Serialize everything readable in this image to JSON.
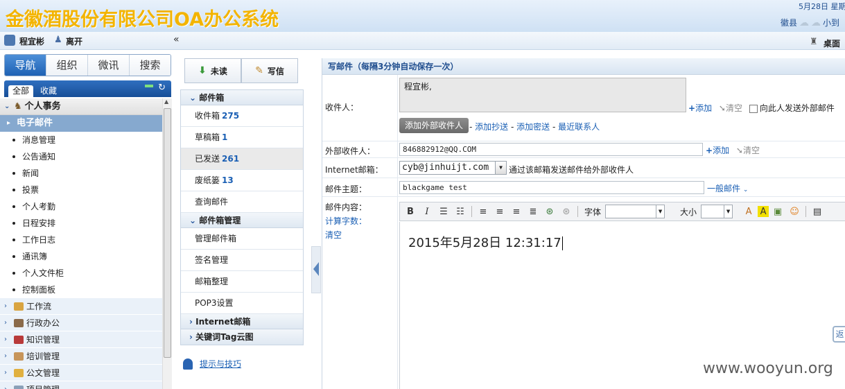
{
  "header": {
    "app_title": "金徽酒股份有限公司OA办公系统",
    "date": "5月28日 星期",
    "weather_label": "徽县",
    "weather_text": "小到"
  },
  "userbar": {
    "user_name": "程宜彬",
    "leave_label": "离开",
    "collapse_glyph": "«",
    "desktop_label": "桌面"
  },
  "nav": {
    "tabs": [
      "导航",
      "组织",
      "微讯",
      "搜索"
    ],
    "subtabs": [
      "全部",
      "收藏"
    ],
    "section": "个人事务",
    "selected": "电子邮件",
    "leaves": [
      "消息管理",
      "公告通知",
      "新闻",
      "投票",
      "个人考勤",
      "日程安排",
      "工作日志",
      "通讯簿",
      "个人文件柜",
      "控制面板"
    ],
    "groups": [
      "工作流",
      "行政办公",
      "知识管理",
      "培训管理",
      "公文管理",
      "项目管理"
    ]
  },
  "mail": {
    "unread_label": "未读",
    "compose_label": "写信",
    "mailbox_header": "邮件箱",
    "inbox": "收件箱",
    "inbox_count": "275",
    "drafts": "草稿箱",
    "drafts_count": "1",
    "sent": "已发送",
    "sent_count": "261",
    "trash": "废纸篓",
    "trash_count": "13",
    "search": "查询邮件",
    "manage_header": "邮件箱管理",
    "manage_items": [
      "管理邮件箱",
      "签名管理",
      "邮箱整理",
      "POP3设置"
    ],
    "internet_header": "Internet邮箱",
    "tag_header": "关键词Tag云图",
    "tips": "提示与技巧"
  },
  "compose": {
    "title": "写邮件（每隔3分钟自动保存一次）",
    "to_label": "收件人：",
    "to_value": "程宜彬,",
    "add_link": "添加",
    "clear_link": "清空",
    "ext_send_checkbox": "向此人发送外部邮件",
    "ext_recipient_button": "添加外部收件人",
    "cc_link": "添加抄送",
    "bcc_link": "添加密送",
    "recent_link": "最近联系人",
    "ext_label": "外部收件人：",
    "ext_value": "846882912@QQ.COM",
    "internet_label": "Internet邮箱：",
    "internet_value": "cyb@jinhuijt.com",
    "internet_hint": "通过该邮箱发送邮件给外部收件人",
    "subject_label": "邮件主题：",
    "subject_value": "blackgame test",
    "priority_link": "一般邮件",
    "content_label": "邮件内容：",
    "count_link": "计算字数：",
    "clear_content_link": "清空",
    "font_label": "字体",
    "size_label": "大小",
    "body_text": "2015年5月28日 12:31:17",
    "side_button": "返"
  },
  "watermark": "www.wooyun.org",
  "colors": {
    "logo": "#f3b400",
    "accent": "#1f62b4",
    "link": "#1a5fb4"
  }
}
